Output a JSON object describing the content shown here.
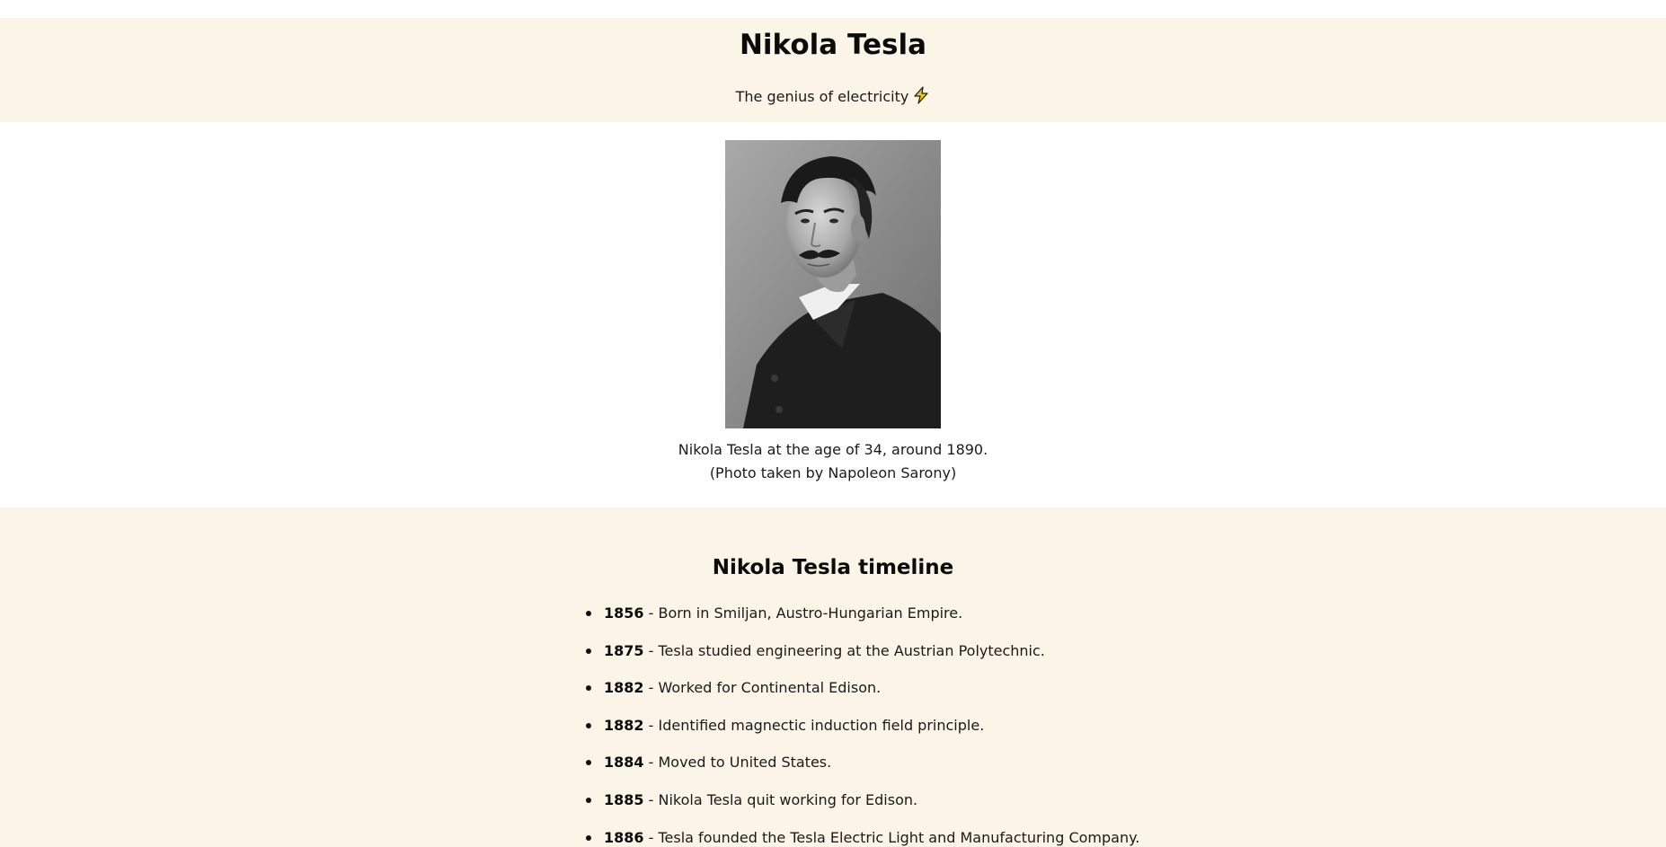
{
  "header": {
    "title": "Nikola Tesla",
    "tagline": "The genius of electricity",
    "tagline_icon": "lightning-bolt-icon"
  },
  "portrait": {
    "alt": "Nikola Tesla portrait photograph",
    "caption_line1": "Nikola Tesla at the age of 34, around 1890.",
    "caption_line2": "(Photo taken by Napoleon Sarony)"
  },
  "timeline": {
    "heading": "Nikola Tesla timeline",
    "separator": " - ",
    "items": [
      {
        "year": "1856",
        "text": "Born in Smiljan, Austro-Hungarian Empire."
      },
      {
        "year": "1875",
        "text": "Tesla studied engineering at the Austrian Polytechnic."
      },
      {
        "year": "1882",
        "text": "Worked for Continental Edison."
      },
      {
        "year": "1882",
        "text": "Identified magnectic induction field principle."
      },
      {
        "year": "1884",
        "text": "Moved to United States."
      },
      {
        "year": "1885",
        "text": "Nikola Tesla quit working for Edison."
      },
      {
        "year": "1886",
        "text": "Tesla founded the Tesla Electric Light and Manufacturing Company."
      }
    ]
  },
  "colors": {
    "section_background": "#fbf5e8",
    "page_background": "#ffffff",
    "text": "#111111",
    "bolt_fill": "#f5c518"
  }
}
